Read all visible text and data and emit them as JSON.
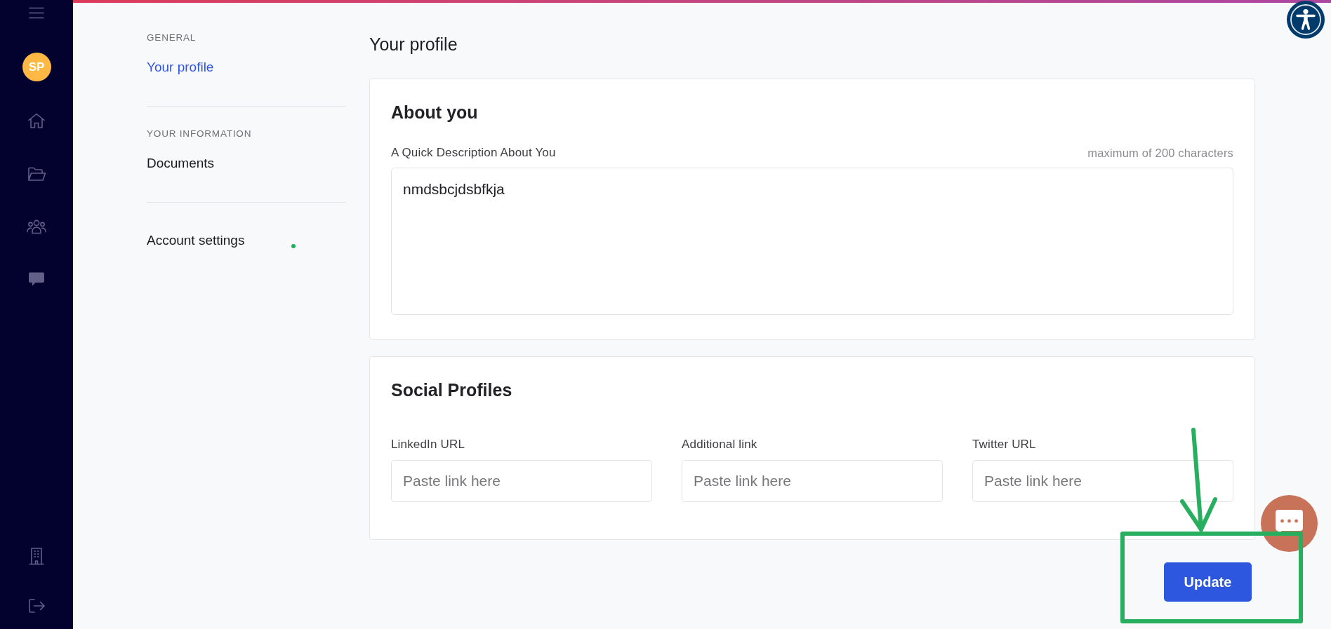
{
  "sidebar": {
    "avatar": {
      "initials": "SP"
    }
  },
  "settings_nav": {
    "sections": [
      {
        "heading": "GENERAL",
        "items": [
          {
            "label": "Your profile",
            "selected": true,
            "status_dot": false
          }
        ]
      },
      {
        "heading": "YOUR INFORMATION",
        "items": [
          {
            "label": "Documents",
            "selected": false,
            "status_dot": false
          }
        ]
      },
      {
        "items": [
          {
            "label": "Account settings",
            "selected": false,
            "status_dot": true
          }
        ]
      }
    ]
  },
  "page": {
    "title": "Your profile"
  },
  "about_card": {
    "title": "About you",
    "label": "A Quick Description About You",
    "hint": "maximum of 200 characters",
    "value": "nmdsbcjdsbfkja"
  },
  "social_card": {
    "title": "Social Profiles",
    "fields": [
      {
        "label": "LinkedIn URL",
        "placeholder": "Paste link here"
      },
      {
        "label": "Additional link",
        "placeholder": "Paste link here"
      },
      {
        "label": "Twitter URL",
        "placeholder": "Paste link here"
      }
    ]
  },
  "update_button": {
    "label": "Update"
  }
}
